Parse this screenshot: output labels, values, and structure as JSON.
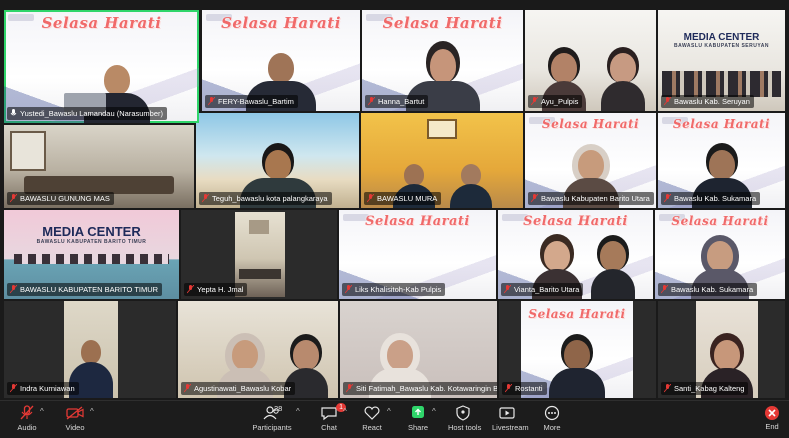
{
  "tiles": [
    {
      "name": "Yustedi_Bawaslu Lamandau (Narasumber)",
      "banner": "Selasa Harati",
      "kind": "slide",
      "active": true
    },
    {
      "name": "FERY-Bawaslu_Bartim",
      "banner": "Selasa Harati",
      "kind": "slide"
    },
    {
      "name": "Hanna_Bartut",
      "banner": "Selasa Harati",
      "kind": "slide"
    },
    {
      "name": "Ayu_Pulpis",
      "kind": "room"
    },
    {
      "name": "Bawaslu Kab. Seruyan",
      "kind": "media",
      "media_title": "MEDIA CENTER",
      "media_sub": "BAWASLU KABUPATEN SERUYAN"
    },
    {
      "name": "BAWASLU GUNUNG MAS",
      "kind": "room"
    },
    {
      "name": "Teguh_bawaslu kota palangkaraya",
      "kind": "beach"
    },
    {
      "name": "BAWASLU MURA",
      "kind": "yellow"
    },
    {
      "name": "Bawaslu Kabupaten Barito Utara",
      "banner": "Selasa Harati",
      "kind": "slide"
    },
    {
      "name": "Bawaslu Kab. Sukamara",
      "banner": "Selasa Harati",
      "kind": "slide"
    },
    {
      "name": "BAWASLU KABUPATEN BARITO TIMUR",
      "kind": "media-pink",
      "media_title": "MEDIA CENTER",
      "media_sub": "BAWASLU KABUPATEN BARITO TIMUR"
    },
    {
      "name": "Yepta H. Jmal",
      "kind": "room"
    },
    {
      "name": "Liks Khalisitoh-Kab Pulpis",
      "banner": "Selasa Harati",
      "kind": "slide"
    },
    {
      "name": "Vianta_Barito Utara",
      "banner": "Selasa Harati",
      "kind": "slide"
    },
    {
      "name": "Bawaslu Kab. Sukamara",
      "banner": "Selasa Harati",
      "kind": "slide"
    },
    {
      "name": "Indra Kurniawan",
      "kind": "room"
    },
    {
      "name": "Agustinawati_Bawaslu Kobar",
      "kind": "room"
    },
    {
      "name": "Siti Fatimah_Bawaslu Kab. Kotawaringin Barat",
      "kind": "soft"
    },
    {
      "name": "Rostanti",
      "banner": "Selasa Harati",
      "kind": "slide"
    },
    {
      "name": "Santi_Kabag Kalteng",
      "kind": "warm"
    }
  ],
  "toolbar": {
    "audio": "Audio",
    "video": "Video",
    "participants": "Participants",
    "participants_count": "28",
    "chat": "Chat",
    "chat_badge": "1",
    "react": "React",
    "share": "Share",
    "host_tools": "Host tools",
    "livestream": "Livestream",
    "more": "More",
    "end": "End"
  },
  "colors": {
    "active_border": "#2fd56a",
    "share_green": "#2fd56a",
    "end_red": "#e53935",
    "banner_pink": "#f06a6a"
  }
}
